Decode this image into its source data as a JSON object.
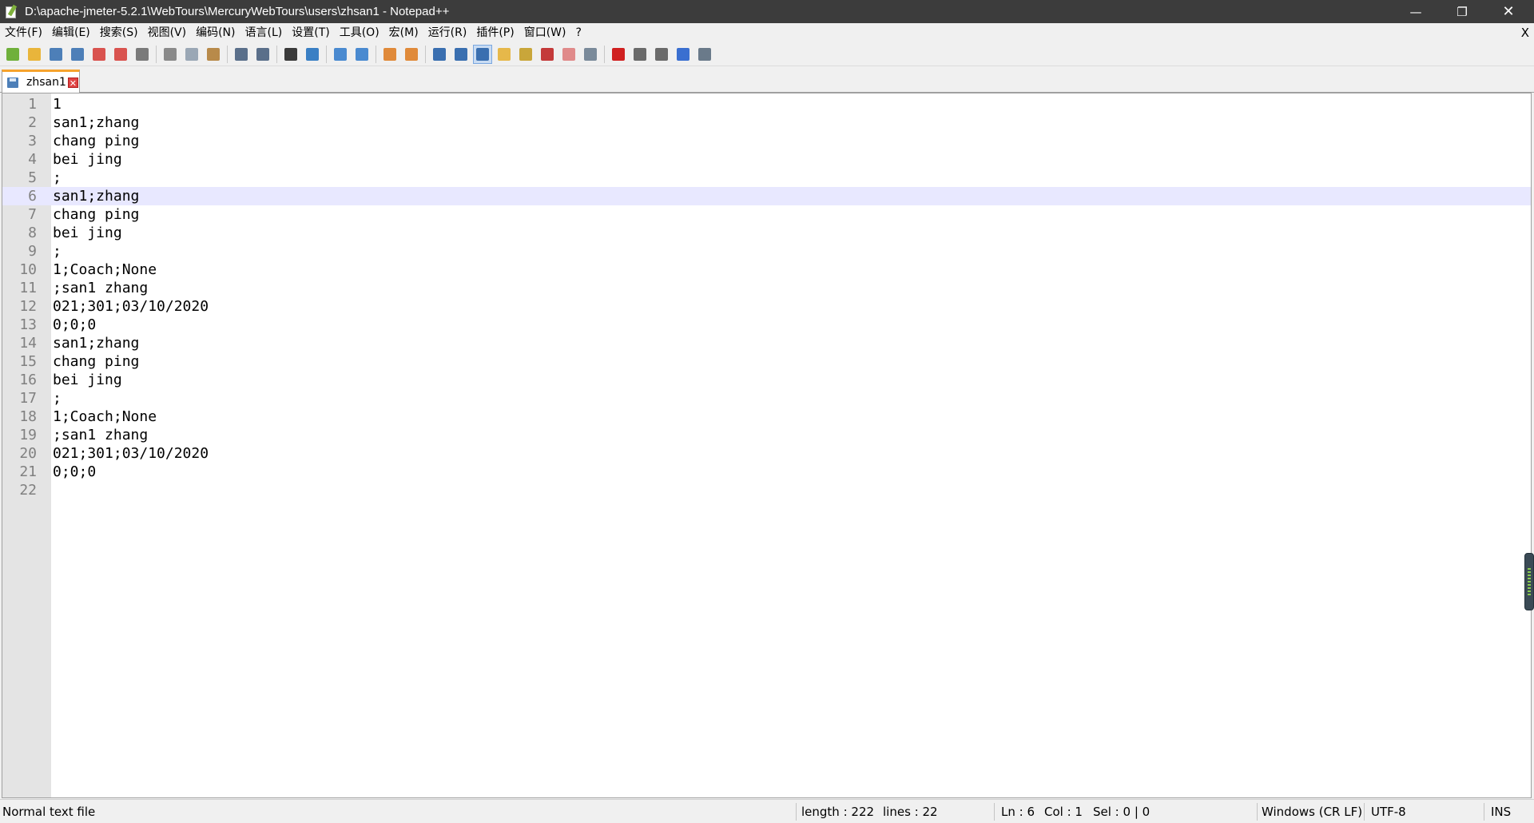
{
  "window": {
    "title": "D:\\apache-jmeter-5.2.1\\WebTours\\MercuryWebTours\\users\\zhsan1 - Notepad++",
    "minimize_glyph": "—",
    "maximize_glyph": "❐",
    "close_glyph": "✕"
  },
  "menubar": {
    "items": [
      "文件(F)",
      "编辑(E)",
      "搜索(S)",
      "视图(V)",
      "编码(N)",
      "语言(L)",
      "设置(T)",
      "工具(O)",
      "宏(M)",
      "运行(R)",
      "插件(P)",
      "窗口(W)",
      "?"
    ],
    "close_label": "X"
  },
  "toolbar": {
    "icons": [
      {
        "name": "new-file-icon",
        "color": "#6fb03b"
      },
      {
        "name": "open-file-icon",
        "color": "#e9b53b"
      },
      {
        "name": "save-icon",
        "color": "#4d7fb8"
      },
      {
        "name": "save-all-icon",
        "color": "#4d7fb8"
      },
      {
        "name": "close-file-icon",
        "color": "#d9534f"
      },
      {
        "name": "close-all-icon",
        "color": "#d9534f"
      },
      {
        "name": "print-icon",
        "color": "#7a7a7a"
      },
      {
        "sep": true
      },
      {
        "name": "cut-icon",
        "color": "#8a8a8a"
      },
      {
        "name": "copy-icon",
        "color": "#9aa7b5"
      },
      {
        "name": "paste-icon",
        "color": "#b88a4a"
      },
      {
        "sep": true
      },
      {
        "name": "undo-icon",
        "color": "#5a6f8a"
      },
      {
        "name": "redo-icon",
        "color": "#5a6f8a"
      },
      {
        "sep": true
      },
      {
        "name": "find-icon",
        "color": "#3a3a3a"
      },
      {
        "name": "replace-icon",
        "color": "#3a7fc4"
      },
      {
        "sep": true
      },
      {
        "name": "zoom-in-icon",
        "color": "#4a8ad0"
      },
      {
        "name": "zoom-out-icon",
        "color": "#4a8ad0"
      },
      {
        "sep": true
      },
      {
        "name": "sync-vertical-icon",
        "color": "#e08a3a"
      },
      {
        "name": "sync-horizontal-icon",
        "color": "#e08a3a"
      },
      {
        "sep": true
      },
      {
        "name": "word-wrap-icon",
        "color": "#3a6fb0"
      },
      {
        "name": "show-all-chars-icon",
        "color": "#3a6fb0"
      },
      {
        "name": "indent-guide-icon",
        "color": "#3a6fb0",
        "active": true
      },
      {
        "name": "user-language-icon",
        "color": "#e6b84a"
      },
      {
        "name": "document-map-icon",
        "color": "#c9a63a"
      },
      {
        "name": "function-list-icon",
        "color": "#c43a3a"
      },
      {
        "name": "folder-workspace-icon",
        "color": "#e08a8a"
      },
      {
        "name": "monitoring-icon",
        "color": "#7a8a9a"
      },
      {
        "sep": true
      },
      {
        "name": "record-macro-icon",
        "color": "#d02020"
      },
      {
        "name": "stop-macro-icon",
        "color": "#6a6a6a"
      },
      {
        "name": "play-macro-icon",
        "color": "#6a6a6a"
      },
      {
        "name": "run-macro-multiple-icon",
        "color": "#3a6fd0"
      },
      {
        "name": "save-macro-icon",
        "color": "#6a7a8a"
      }
    ]
  },
  "tab": {
    "label": "zhsan1",
    "close_glyph": "✕"
  },
  "editor": {
    "current_line": 6,
    "lines": [
      "1",
      "san1;zhang",
      "chang ping",
      "bei jing",
      ";",
      "san1;zhang",
      "chang ping",
      "bei jing",
      ";",
      "1;Coach;None",
      ";san1 zhang",
      "021;301;03/10/2020",
      "0;0;0",
      "san1;zhang",
      "chang ping",
      "bei jing",
      ";",
      "1;Coach;None",
      ";san1 zhang",
      "021;301;03/10/2020",
      "0;0;0",
      ""
    ]
  },
  "statusbar": {
    "file_type": "Normal text file",
    "length": "length : 222",
    "lines": "lines : 22",
    "ln": "Ln : 6",
    "col": "Col : 1",
    "sel": "Sel : 0 | 0",
    "eol": "Windows (CR LF)",
    "encoding": "UTF-8",
    "mode": "INS"
  }
}
